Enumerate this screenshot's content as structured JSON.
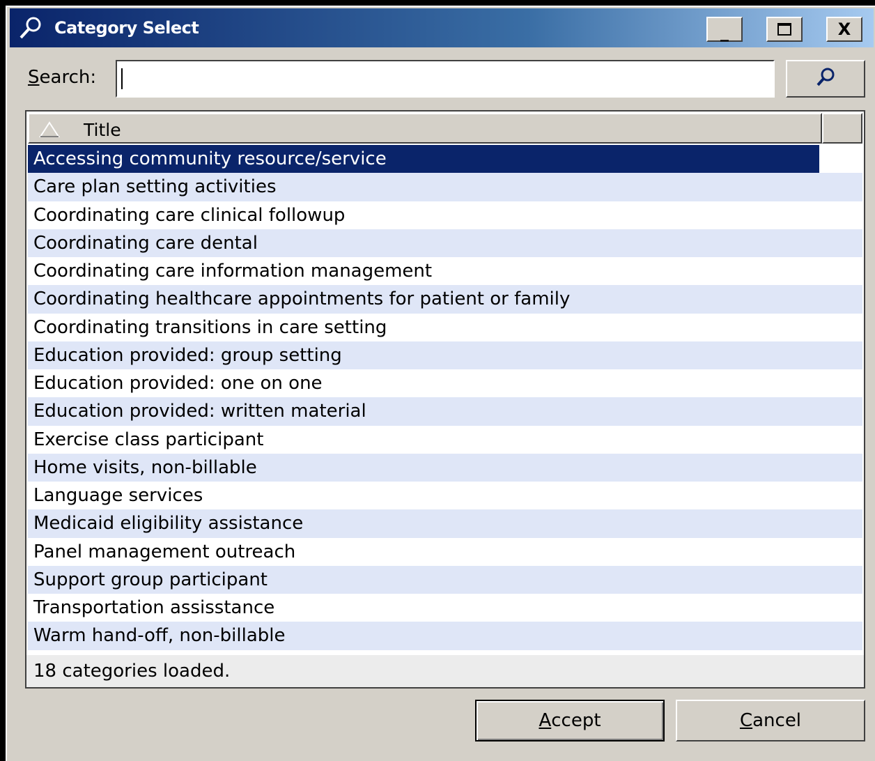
{
  "window": {
    "title": "Category Select",
    "controls": {
      "minimize": "_",
      "maximize": "□",
      "close": "X"
    }
  },
  "search": {
    "label_access_key": "S",
    "label_rest": "earch:",
    "value": "",
    "button_icon": "search-icon"
  },
  "list": {
    "column_title": "Title",
    "sort_icon": "sort-ascending-icon",
    "items": [
      "Accessing community resource/service",
      "Care plan setting activities",
      "Coordinating care clinical followup",
      "Coordinating care dental",
      "Coordinating care information management",
      "Coordinating healthcare appointments for patient or family",
      "Coordinating transitions in care setting",
      "Education provided: group setting",
      "Education provided: one on one",
      "Education provided: written material",
      "Exercise class participant",
      "Home visits, non-billable",
      "Language services",
      "Medicaid eligibility assistance",
      "Panel management outreach",
      "Support group participant",
      "Transportation assisstance",
      "Warm hand-off, non-billable"
    ],
    "selected_index": 0,
    "status": "18 categories loaded."
  },
  "buttons": {
    "accept_key": "A",
    "accept_rest": "ccept",
    "cancel_key": "C",
    "cancel_rest": "ancel"
  },
  "colors": {
    "title_gradient_start": "#0a246a",
    "selection": "#0a246a",
    "row_alt": "#dfe6f7",
    "face": "#d4d0c8"
  }
}
